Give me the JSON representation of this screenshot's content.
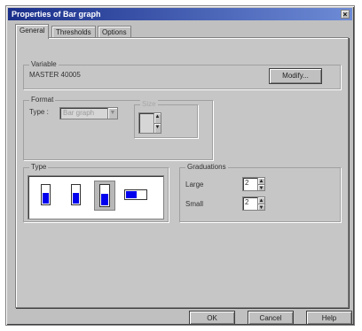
{
  "window": {
    "title": "Properties of Bar graph",
    "close_symbol": "×"
  },
  "tabs": [
    {
      "label": "General",
      "active": true
    },
    {
      "label": "Thresholds",
      "active": false
    },
    {
      "label": "Options",
      "active": false
    }
  ],
  "variable_group": {
    "label": "Variable",
    "value": "MASTER 40005",
    "modify_label": "Modify..."
  },
  "format_group": {
    "label": "Format",
    "type_label": "Type :",
    "type_value": "Bar graph",
    "inner_label": "Size"
  },
  "type_group": {
    "label": "Type",
    "icons": [
      "vertical-bar-icon",
      "vertical-bar-right-icon",
      "vertical-bar-selected-icon",
      "horizontal-bar-icon"
    ],
    "selected_index": 2
  },
  "graduations_group": {
    "label": "Graduations",
    "large_label": "Large",
    "large_value": "2",
    "small_label": "Small",
    "small_value": "2"
  },
  "footer": {
    "ok_label": "OK",
    "cancel_label": "Cancel",
    "help_label": "Help"
  },
  "colors": {
    "title_bar": "#1a2f8a",
    "bar_fill": "#0000ee",
    "dialog_bg": "#c0c0c0"
  }
}
